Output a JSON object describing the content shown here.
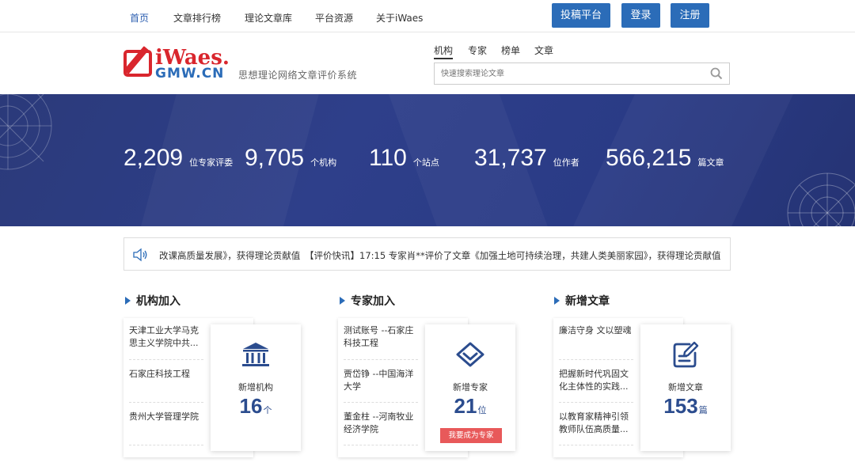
{
  "nav": {
    "items": [
      "首页",
      "文章排行榜",
      "理论文章库",
      "平台资源",
      "关于iWaes"
    ],
    "buttons": [
      "投稿平台",
      "登录",
      "注册"
    ]
  },
  "logo": {
    "brand": "iWaes.",
    "domain": "GMW.CN",
    "subtitle": "思想理论网络文章评价系统"
  },
  "search": {
    "tabs": [
      "机构",
      "专家",
      "榜单",
      "文章"
    ],
    "placeholder": "快速搜索理论文章"
  },
  "stats": [
    {
      "value": "2,209",
      "unit": "位专家评委"
    },
    {
      "value": "9,705",
      "unit": "个机构"
    },
    {
      "value": "110",
      "unit": "个站点"
    },
    {
      "value": "31,737",
      "unit": "位作者"
    },
    {
      "value": "566,215",
      "unit": "篇文章"
    }
  ],
  "ticker": {
    "text": "改课高质量发展》，获得理论贡献值　【评价快讯】17:15 专家肖**评价了文章《加强土地可持续治理，共建人类美丽家园》，获得理论贡献值"
  },
  "sections": {
    "institutions": {
      "title": "机构加入",
      "items": [
        "天津工业大学马克思主义学院中共...",
        "石家庄科技工程",
        "贵州大学管理学院"
      ],
      "card_label": "新增机构",
      "card_num": "16",
      "card_unit": "个"
    },
    "experts": {
      "title": "专家加入",
      "items": [
        "测试账号 --石家庄科技工程",
        "贾岱铮 --中国海洋大学",
        "董金柱 --河南牧业经济学院"
      ],
      "card_label": "新增专家",
      "card_num": "21",
      "card_unit": "位",
      "button": "我要成为专家"
    },
    "articles": {
      "title": "新增文章",
      "items": [
        "廉洁守身 文以塑魂",
        "把握新时代巩固文化主体性的实践...",
        "以教育家精神引领教师队伍高质量..."
      ],
      "card_label": "新增文章",
      "card_num": "153",
      "card_unit": "篇"
    }
  },
  "colors": {
    "accent": "#2b6cb8",
    "brand_red": "#d9262d",
    "banner": "#2e3f8a",
    "stat_number": "#2b4c8e",
    "cta": "#e8595a"
  }
}
